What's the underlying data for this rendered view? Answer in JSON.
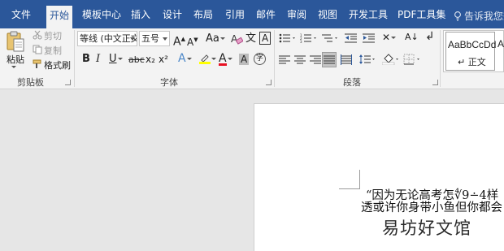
{
  "tabs": {
    "file": "文件",
    "home": "开始",
    "template": "模板中心",
    "insert": "插入",
    "design": "设计",
    "layout": "布局",
    "references": "引用",
    "mailings": "邮件",
    "review": "审阅",
    "view": "视图",
    "developer": "开发工具",
    "pdf": "PDF工具集",
    "tell_me": "告诉我您想"
  },
  "clipboard": {
    "paste": "粘贴",
    "cut": "剪切",
    "copy": "复制",
    "format_painter": "格式刷",
    "group_label": "剪贴板"
  },
  "font": {
    "font_name": "等线 (中文正文",
    "font_size": "五号",
    "grow": "A",
    "shrink": "A",
    "change_case": "Aa",
    "bold": "B",
    "italic": "I",
    "underline": "U",
    "strike": "abc",
    "subscript": "x₂",
    "superscript": "x²",
    "text_effect": "A",
    "font_color": "A",
    "shading": "A",
    "enclose": "字",
    "group_label": "字体"
  },
  "paragraph": {
    "group_label": "段落"
  },
  "styles": {
    "preview": "AaBbCcDd",
    "name": "正文",
    "second_preview": "A"
  },
  "document": {
    "line1": "“因为无论高考怎",
    "line1_glitch": "∜9∸4样",
    "line2": "透或许你身带小鱼但你都会",
    "watermark": "易坊好文馆"
  },
  "colors": {
    "tab_bar": "#2b579a",
    "ribbon": "#f3f3f3",
    "font_color_bar": "#e81123",
    "highlight_bar": "#ffff00"
  }
}
